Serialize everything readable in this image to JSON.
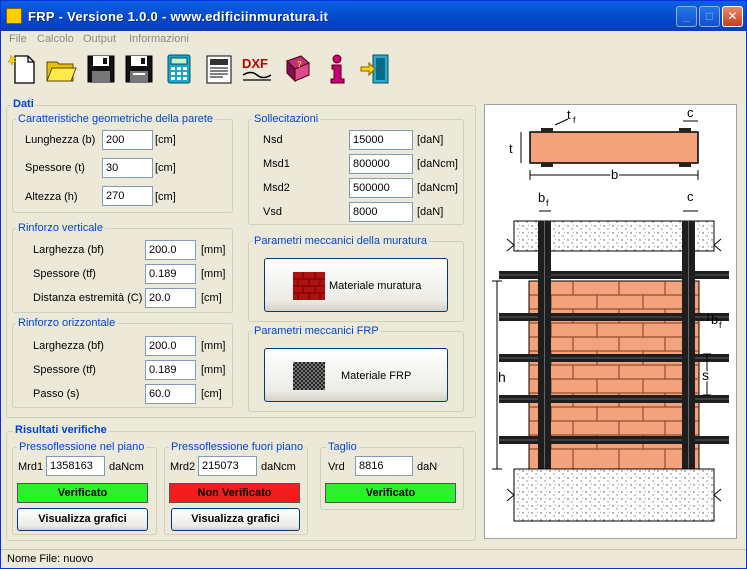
{
  "window": {
    "title": "FRP  -  Versione 1.0.0  -  www.edificiinmuratura.it"
  },
  "title_buttons": {
    "minimize": "_",
    "maximize": "□",
    "close": "✕"
  },
  "menu": [
    "File",
    "Calcolo",
    "Output",
    "Informazioni"
  ],
  "toolbar": {
    "dxf_label": "DXF"
  },
  "dati": {
    "title": "Dati",
    "geometria": {
      "title": "Caratteristiche geometriche della parete",
      "rows": [
        {
          "label": "Lunghezza (b)",
          "value": "200",
          "unit": "[cm]"
        },
        {
          "label": "Spessore (t)",
          "value": "30",
          "unit": "[cm]"
        },
        {
          "label": "Altezza (h)",
          "value": "270",
          "unit": "[cm]"
        }
      ]
    },
    "sollecitazioni": {
      "title": "Sollecitazioni",
      "rows": [
        {
          "label": "Nsd",
          "value": "15000",
          "unit": "[daN]"
        },
        {
          "label": "Msd1",
          "value": "800000",
          "unit": "[daNcm]"
        },
        {
          "label": "Msd2",
          "value": "500000",
          "unit": "[daNcm]"
        },
        {
          "label": "Vsd",
          "value": "8000",
          "unit": "[daN]"
        }
      ]
    },
    "rinforzo_verticale": {
      "title": "Rinforzo verticale",
      "rows": [
        {
          "label": "Larghezza (bf)",
          "value": "200.0",
          "unit": "[mm]"
        },
        {
          "label": "Spessore (tf)",
          "value": "0.189",
          "unit": "[mm]"
        },
        {
          "label": "Distanza estremità (C)",
          "value": "20.0",
          "unit": "[cm]"
        }
      ]
    },
    "rinforzo_orizzontale": {
      "title": "Rinforzo orizzontale",
      "rows": [
        {
          "label": "Larghezza (bf)",
          "value": "200.0",
          "unit": "[mm]"
        },
        {
          "label": "Spessore (tf)",
          "value": "0.189",
          "unit": "[mm]"
        },
        {
          "label": "Passo (s)",
          "value": "60.0",
          "unit": "[cm]"
        }
      ]
    },
    "muratura": {
      "title": "Parametri meccanici della muratura",
      "button": "Materiale muratura"
    },
    "frp": {
      "title": "Parametri meccanici FRP",
      "button": "Materiale FRP"
    }
  },
  "risultati": {
    "title": "Risultati verifiche",
    "nel_piano": {
      "title": "Pressoflessione nel piano",
      "label": "Mrd1",
      "value": "1358163",
      "unit": "daNcm",
      "status": "Verificato",
      "button": "Visualizza grafici"
    },
    "fuori_piano": {
      "title": "Pressoflessione fuori piano",
      "label": "Mrd2",
      "value": "215073",
      "unit": "daNcm",
      "status": "Non Verificato",
      "button": "Visualizza grafici"
    },
    "taglio": {
      "title": "Taglio",
      "label": "Vrd",
      "value": "8816",
      "unit": "daN",
      "status": "Verificato"
    }
  },
  "drawing_labels": {
    "tf": "t",
    "tf_sub": "f",
    "c": "c",
    "t": "t",
    "b": "b",
    "bf": "b",
    "bf_sub": "f",
    "h": "h",
    "s": "s"
  },
  "statusbar": {
    "text": "Nome File: nuovo"
  },
  "colors": {
    "ok": "#2cf02c",
    "bad": "#f41c1c",
    "brick": "#f4a27c",
    "accent": "#0046d5"
  }
}
